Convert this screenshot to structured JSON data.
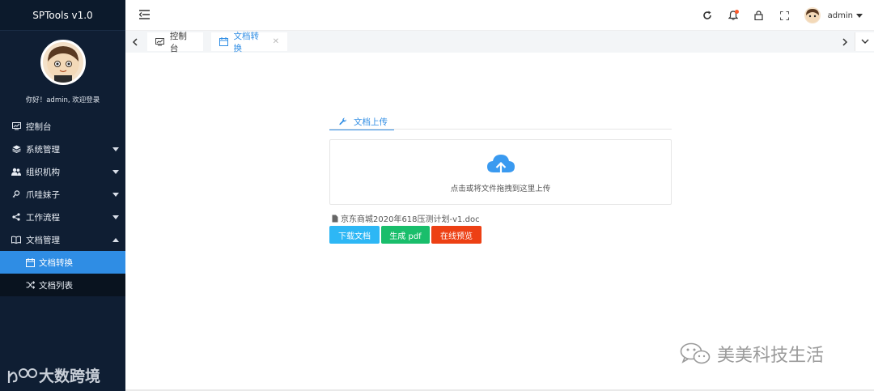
{
  "app": {
    "title": "SPTools v1.0",
    "welcome": "你好！admin, 欢迎登录"
  },
  "sidebar": {
    "items": [
      {
        "label": "控制台",
        "icon": "monitor-icon"
      },
      {
        "label": "系统管理",
        "icon": "layers-icon"
      },
      {
        "label": "组织机构",
        "icon": "users-icon"
      },
      {
        "label": "爪哇妹子",
        "icon": "key-icon"
      },
      {
        "label": "工作流程",
        "icon": "share-icon"
      },
      {
        "label": "文档管理",
        "icon": "book-icon"
      }
    ],
    "subitems": [
      {
        "label": "文档转换",
        "icon": "calendar-icon",
        "active": true
      },
      {
        "label": "文档列表",
        "icon": "shuffle-icon",
        "active": false
      }
    ],
    "logo_text": "大数跨境"
  },
  "header": {
    "user": "admin"
  },
  "tabs": [
    {
      "label": "控制台"
    },
    {
      "label": "文档转换"
    }
  ],
  "main": {
    "upload_tab": "文档上传",
    "drop_text": "点击或将文件拖拽到这里上传",
    "file_name": "京东商城2020年618压测计划-v1.doc",
    "buttons": {
      "download": "下载文档",
      "pdf": "生成 pdf",
      "preview": "在线预览"
    }
  },
  "watermark": "美美科技生活",
  "colors": {
    "accent": "#2f8de4",
    "sidebar": "#0f1e33",
    "download": "#2db7f5",
    "pdf": "#19be6b",
    "preview": "#ed4014"
  }
}
